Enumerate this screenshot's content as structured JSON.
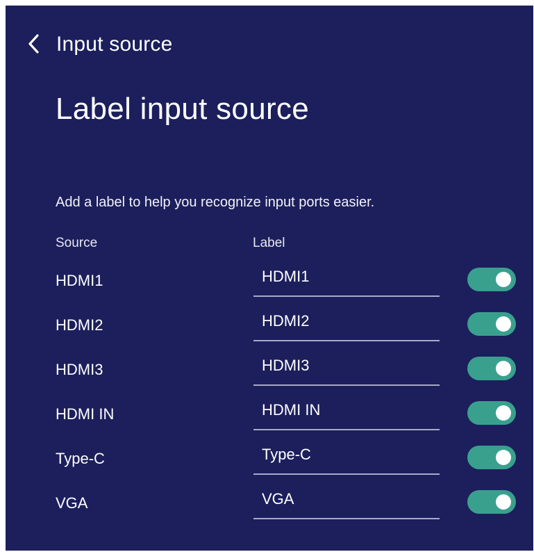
{
  "header": {
    "back_icon": "chevron-left-icon",
    "breadcrumb": "Input source"
  },
  "page": {
    "title": "Label input source",
    "description": "Add a label to help you recognize input ports easier."
  },
  "columns": {
    "source": "Source",
    "label": "Label"
  },
  "rows": [
    {
      "source": "HDMI1",
      "label": "HDMI1",
      "enabled": true
    },
    {
      "source": "HDMI2",
      "label": "HDMI2",
      "enabled": true
    },
    {
      "source": "HDMI3",
      "label": "HDMI3",
      "enabled": true
    },
    {
      "source": "HDMI IN",
      "label": "HDMI IN",
      "enabled": true
    },
    {
      "source": "Type-C",
      "label": "Type-C",
      "enabled": true
    },
    {
      "source": "VGA",
      "label": "VGA",
      "enabled": true
    }
  ],
  "colors": {
    "background": "#1c1f5c",
    "toggle_on": "#3aa08e",
    "underline": "#a9abc8"
  }
}
